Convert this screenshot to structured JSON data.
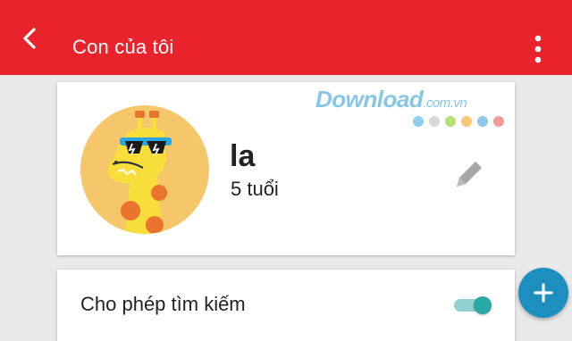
{
  "appbar": {
    "title": "Con của tôi",
    "back_icon": "arrow-back-icon",
    "menu_icon": "more-vert-icon",
    "color": "#e8232b"
  },
  "profile": {
    "name": "la",
    "age": "5 tuổi",
    "avatar_icon": "giraffe-avatar",
    "edit_icon": "pencil-icon"
  },
  "settings": {
    "search_label": "Cho phép tìm kiếm",
    "search_enabled": true,
    "toggle_color": "#28a9a7"
  },
  "fab": {
    "icon": "add-icon",
    "color": "#1d8fbf"
  },
  "watermark": {
    "text": "Download",
    "tld": ".com.vn",
    "dot_colors": [
      "#8fd0ee",
      "#d8d8d8",
      "#b8e07a",
      "#f6c97a",
      "#8ec8ec",
      "#f19a9a"
    ]
  }
}
